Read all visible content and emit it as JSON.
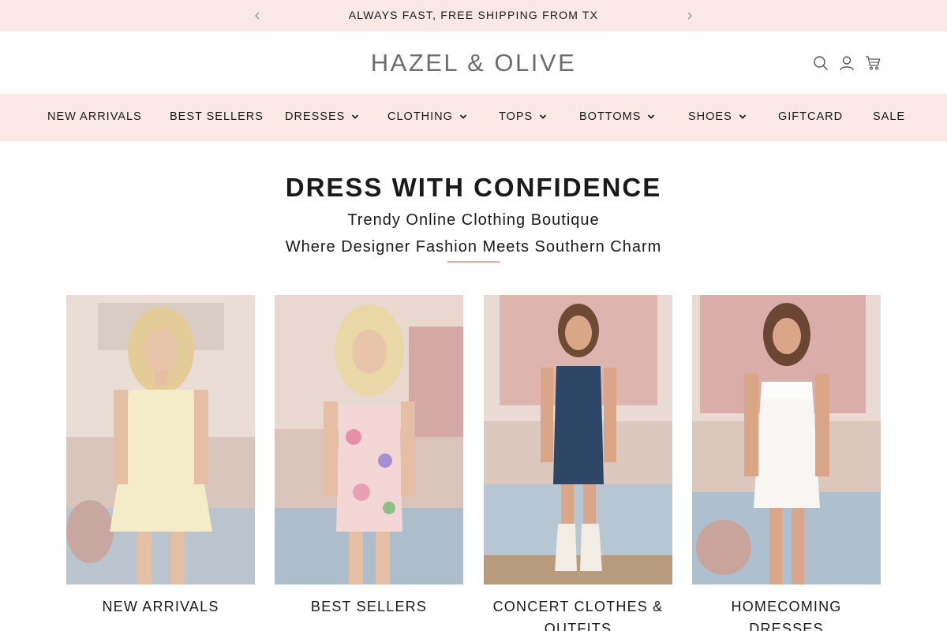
{
  "announcement": {
    "text": "ALWAYS FAST, FREE SHIPPING FROM TX",
    "prev_icon": "chevron-left-icon",
    "next_icon": "chevron-right-icon"
  },
  "header": {
    "logo": "HAZEL & OLIVE",
    "icons": [
      "search-icon",
      "account-icon",
      "cart-icon"
    ]
  },
  "nav": {
    "items": [
      {
        "label": "NEW ARRIVALS",
        "dropdown": false
      },
      {
        "label": "BEST SELLERS",
        "dropdown": false
      },
      {
        "label": "DRESSES",
        "dropdown": true
      },
      {
        "label": "CLOTHING",
        "dropdown": true
      },
      {
        "label": "TOPS",
        "dropdown": true
      },
      {
        "label": "BOTTOMS",
        "dropdown": true
      },
      {
        "label": "SHOES",
        "dropdown": true
      },
      {
        "label": "GIFTCARD",
        "dropdown": false
      },
      {
        "label": "SALE",
        "dropdown": false
      }
    ]
  },
  "hero": {
    "title": "DRESS WITH CONFIDENCE",
    "subtitle_line1": "Trendy Online Clothing Boutique",
    "subtitle_line2": "Where Designer Fashion Meets Southern Charm"
  },
  "collections": [
    {
      "label": "NEW ARRIVALS"
    },
    {
      "label": "BEST SELLERS"
    },
    {
      "label": "CONCERT CLOTHES & OUTFITS"
    },
    {
      "label": "HOMECOMING DRESSES"
    }
  ],
  "colors": {
    "accent_bar": "#f9e8e6",
    "rule": "#e8a7ac",
    "text": "#1a1a1a",
    "logo": "#6d6d6d"
  }
}
